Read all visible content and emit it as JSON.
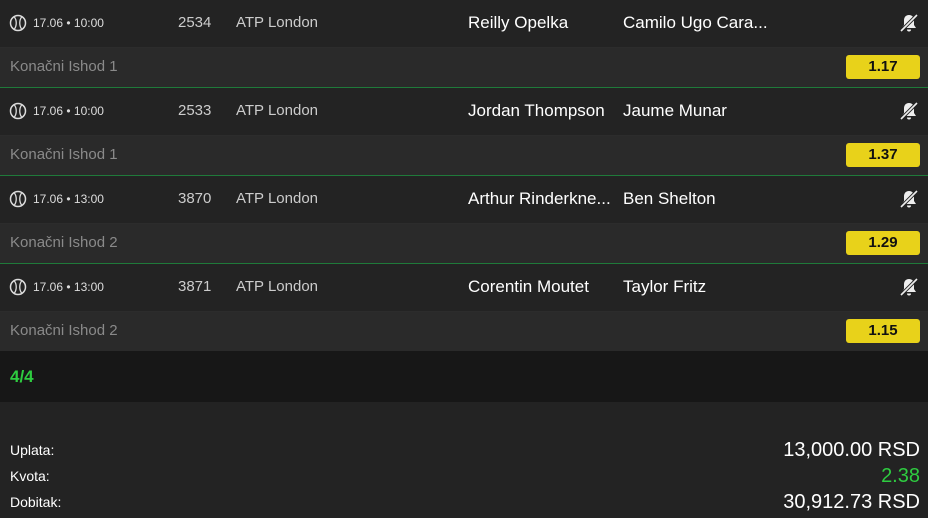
{
  "matches": [
    {
      "time": "17.06 • 10:00",
      "code": "2534",
      "league": "ATP London",
      "home": "Reilly Opelka",
      "away": "Camilo Ugo Cara...",
      "market": "Konačni Ishod 1",
      "odd": "1.17"
    },
    {
      "time": "17.06 • 10:00",
      "code": "2533",
      "league": "ATP London",
      "home": "Jordan Thompson",
      "away": "Jaume Munar",
      "market": "Konačni Ishod 1",
      "odd": "1.37"
    },
    {
      "time": "17.06 • 13:00",
      "code": "3870",
      "league": "ATP London",
      "home": "Arthur Rinderkne...",
      "away": "Ben Shelton",
      "market": "Konačni Ishod 2",
      "odd": "1.29"
    },
    {
      "time": "17.06 • 13:00",
      "code": "3871",
      "league": "ATP London",
      "home": "Corentin Moutet",
      "away": "Taylor Fritz",
      "market": "Konačni Ishod 2",
      "odd": "1.15"
    }
  ],
  "count_label": "4/4",
  "summary": {
    "stake_label": "Uplata:",
    "stake_value": "13,000.00 RSD",
    "odds_label": "Kvota:",
    "odds_value": "2.38",
    "win_label": "Dobitak:",
    "win_value": "30,912.73 RSD"
  },
  "icons": {
    "sport": "tennis-ball-icon",
    "bell": "bell-off-icon"
  },
  "colors": {
    "accent": "#2ecc40",
    "odd_bg": "#e8d21a"
  }
}
